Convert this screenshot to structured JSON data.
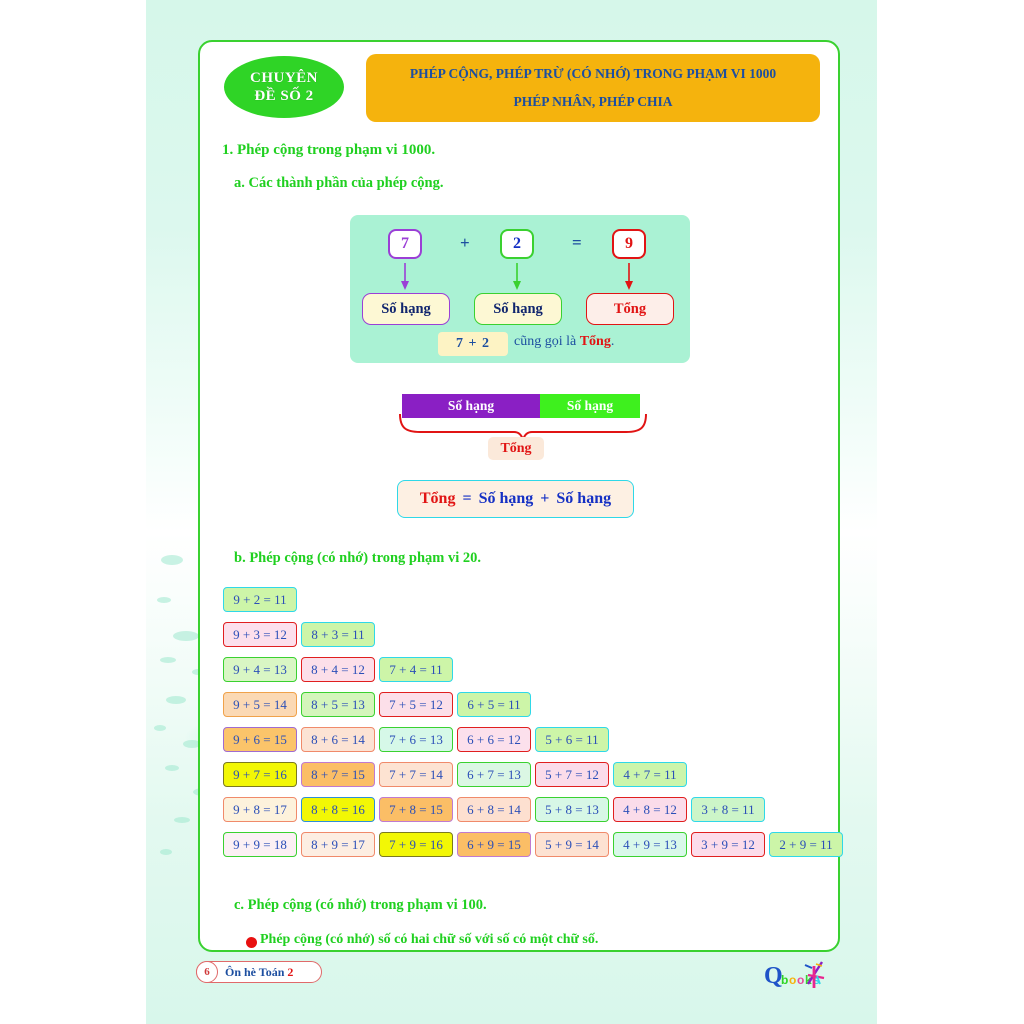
{
  "page": {
    "footer_page_number": "6",
    "footer_label": "Ôn hè Toán ",
    "footer_label_accent": "2",
    "logo_text": "Qbooks"
  },
  "header": {
    "badge_line1": "CHUYÊN",
    "badge_line2": "ĐỀ SỐ 2",
    "title_line1": "PHÉP CỘNG, PHÉP TRỪ (CÓ NHỚ) TRONG PHẠM VI 1000",
    "title_line2": "PHÉP NHÂN, PHÉP CHIA",
    "badge_color": "#2fd426",
    "title_bg": "#f5b30d",
    "title_color": "#1d4fa0"
  },
  "sections": {
    "s1": "1.  Phép cộng trong phạm vi 1000.",
    "s1a": "a.  Các thành phần của phép cộng.",
    "s1b": "b.  Phép cộng (có nhớ) trong phạm vi 20.",
    "s1c": "c.  Phép cộng (có nhớ) trong phạm vi 100.",
    "s1c_bullet": "Phép cộng (có nhớ) số có hai chữ số với số có một chữ số."
  },
  "parts_diagram": {
    "num1": "7",
    "op1": "+",
    "num2": "2",
    "op2": "=",
    "num3": "9",
    "label1": "Số hạng",
    "label2": "Số hạng",
    "label3": "Tổng",
    "expr": "7 + 2",
    "also_text": " cũng gọi là ",
    "also_bold": "Tổng",
    "also_end": ".",
    "color1": "#9b3fd6",
    "color2": "#3ad130",
    "color3": "#e11414",
    "panel_bg": "#aaf2d4"
  },
  "bar_diagram": {
    "left_label": "Số hạng",
    "right_label": "Số hạng",
    "left_color": "#8a1fc4",
    "right_color": "#3ef01e",
    "brace_color": "#e11414",
    "sum_label": "Tổng"
  },
  "formula": {
    "sum": "Tổng",
    "eq": "=",
    "term1": "Số hạng",
    "plus": "+",
    "term2": "Số hạng"
  },
  "chart_data": {
    "type": "table",
    "title": "Phép cộng (có nhớ) trong phạm vi 20",
    "rows": [
      [
        {
          "t": "9 + 2 = 11",
          "bg": "#cdf5a8",
          "bd": "#2fd8e8"
        }
      ],
      [
        {
          "t": "9 + 3 = 12",
          "bg": "#fce0ec",
          "bd": "#e01f1f"
        },
        {
          "t": "8 + 3 = 11",
          "bg": "#cdf5a8",
          "bd": "#2fd8e8"
        }
      ],
      [
        {
          "t": "9 + 4 = 13",
          "bg": "#d9f6c4",
          "bd": "#3ad130"
        },
        {
          "t": "8 + 4 = 12",
          "bg": "#fcdfe9",
          "bd": "#e01f1f"
        },
        {
          "t": "7 + 4 = 11",
          "bg": "#cdf5a8",
          "bd": "#2fd8e8"
        }
      ],
      [
        {
          "t": "9 + 5 = 14",
          "bg": "#fbd9b4",
          "bd": "#f0a24a"
        },
        {
          "t": "8 + 5 = 13",
          "bg": "#d4f5bb",
          "bd": "#3ad130"
        },
        {
          "t": "7 + 5 = 12",
          "bg": "#fcdfe9",
          "bd": "#e01f1f"
        },
        {
          "t": "6 + 5 = 11",
          "bg": "#cdf5a8",
          "bd": "#2fd8e8"
        }
      ],
      [
        {
          "t": "9 + 6 = 15",
          "bg": "#fbc46a",
          "bd": "#a06bd0"
        },
        {
          "t": "8 + 6 = 14",
          "bg": "#fce3d4",
          "bd": "#f08a6a"
        },
        {
          "t": "7 + 6 = 13",
          "bg": "#d6f8e8",
          "bd": "#3ad130"
        },
        {
          "t": "6 + 6 = 12",
          "bg": "#fce0ec",
          "bd": "#e01f1f"
        },
        {
          "t": "5 + 6 = 11",
          "bg": "#cdf5a8",
          "bd": "#2fd8e8"
        }
      ],
      [
        {
          "t": "9 + 7 = 16",
          "bg": "#f2f705",
          "bd": "#7a7a20"
        },
        {
          "t": "8 + 7 = 15",
          "bg": "#fbbe66",
          "bd": "#c07ad0"
        },
        {
          "t": "7 + 7 = 14",
          "bg": "#fde3d2",
          "bd": "#f08a6a"
        },
        {
          "t": "6 + 7 = 13",
          "bg": "#dbf7e4",
          "bd": "#3ad130"
        },
        {
          "t": "5 + 7 = 12",
          "bg": "#fbdcea",
          "bd": "#e01f1f"
        },
        {
          "t": "4 + 7 = 11",
          "bg": "#ccf5ab",
          "bd": "#2fd8e8"
        }
      ],
      [
        {
          "t": "9 + 8 = 17",
          "bg": "#fdf2dc",
          "bd": "#f08a6a"
        },
        {
          "t": "8 + 8 = 16",
          "bg": "#f2f705",
          "bd": "#2e8fd8"
        },
        {
          "t": "7 + 8 = 15",
          "bg": "#fbbe66",
          "bd": "#c07ad0"
        },
        {
          "t": "6 + 8 = 14",
          "bg": "#fde0d0",
          "bd": "#f08a6a"
        },
        {
          "t": "5 + 8 = 13",
          "bg": "#d7f7e6",
          "bd": "#3ad130"
        },
        {
          "t": "4 + 8 = 12",
          "bg": "#fbdcea",
          "bd": "#e01f1f"
        },
        {
          "t": "3 + 8 = 11",
          "bg": "#ccf5c8",
          "bd": "#2fd8e8"
        }
      ],
      [
        {
          "t": "9 + 9 = 18",
          "bg": "#fbf0f4",
          "bd": "#3ad130"
        },
        {
          "t": "8 + 9 = 17",
          "bg": "#fdeee2",
          "bd": "#f08a6a"
        },
        {
          "t": "7 + 9 = 16",
          "bg": "#f2f705",
          "bd": "#7a7a20"
        },
        {
          "t": "6 + 9 = 15",
          "bg": "#fbbe66",
          "bd": "#c07ad0"
        },
        {
          "t": "5 + 9 = 14",
          "bg": "#fde2d2",
          "bd": "#f08a6a"
        },
        {
          "t": "4 + 9 = 13",
          "bg": "#d9f8ea",
          "bd": "#3ad130"
        },
        {
          "t": "3 + 9 = 12",
          "bg": "#fcdcea",
          "bd": "#e01f1f"
        },
        {
          "t": "2 + 9 = 11",
          "bg": "#ccf5a8",
          "bd": "#2fd8e8"
        }
      ]
    ]
  }
}
